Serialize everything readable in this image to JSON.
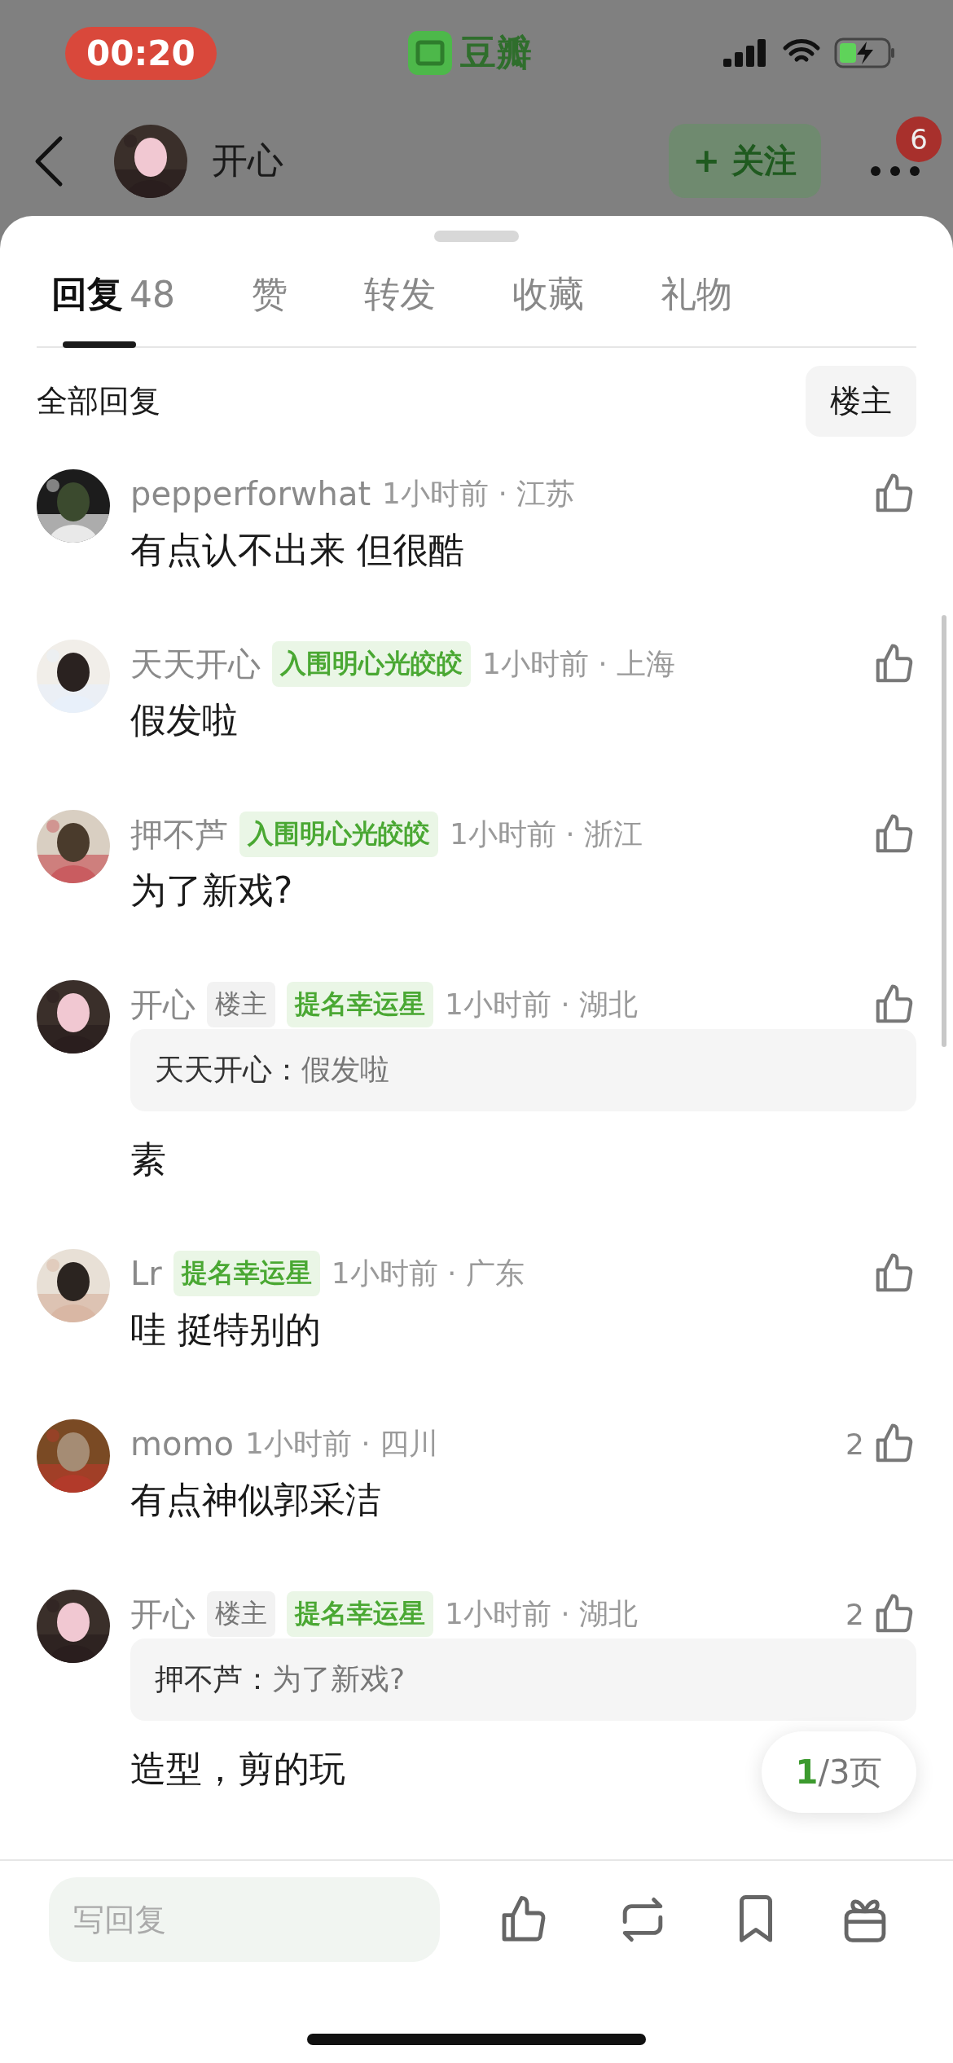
{
  "status_bar": {
    "time": "00:20",
    "app_name": "豆瓣"
  },
  "header": {
    "user_name": "开心",
    "follow_label": "+ 关注",
    "notification_count": "6"
  },
  "tabs": [
    {
      "label": "回复",
      "count": "48",
      "selected": true
    },
    {
      "label": "赞",
      "selected": false
    },
    {
      "label": "转发",
      "selected": false
    },
    {
      "label": "收藏",
      "selected": false
    },
    {
      "label": "礼物",
      "selected": false
    }
  ],
  "filter": {
    "title": "全部回复",
    "button": "楼主"
  },
  "comments": [
    {
      "name": "pepperforwhat",
      "time": "1小时前 · 江苏",
      "text": "有点认不出来 但很酷"
    },
    {
      "name": "天天开心",
      "badges": [
        {
          "kind": "award",
          "text": "入围明心光皎皎"
        }
      ],
      "time": "1小时前 · 上海",
      "text": "假发啦"
    },
    {
      "name": "押不芦",
      "badges": [
        {
          "kind": "award",
          "text": "入围明心光皎皎"
        }
      ],
      "time": "1小时前 · 浙江",
      "text": "为了新戏?"
    },
    {
      "name": "开心",
      "badges": [
        {
          "kind": "op",
          "text": "楼主"
        },
        {
          "kind": "award",
          "text": "提名幸运星"
        }
      ],
      "time": "1小时前 · 湖北",
      "quote": {
        "author": "天天开心：",
        "text": "假发啦"
      },
      "text": "素"
    },
    {
      "name": "Lr",
      "badges": [
        {
          "kind": "award",
          "text": "提名幸运星"
        }
      ],
      "time": "1小时前 · 广东",
      "text": "哇 挺特别的"
    },
    {
      "name": "momo",
      "time": "1小时前 · 四川",
      "likes": "2",
      "text": "有点神似郭采洁"
    },
    {
      "name": "开心",
      "badges": [
        {
          "kind": "op",
          "text": "楼主"
        },
        {
          "kind": "award",
          "text": "提名幸运星"
        }
      ],
      "time": "1小时前 · 湖北",
      "likes": "2",
      "quote": {
        "author": "押不芦：",
        "text": "为了新戏?"
      },
      "text": "造型，剪的玩"
    }
  ],
  "pager": {
    "current": "1",
    "rest": "/3",
    "unit": "页"
  },
  "composer": {
    "placeholder": "写回复"
  }
}
